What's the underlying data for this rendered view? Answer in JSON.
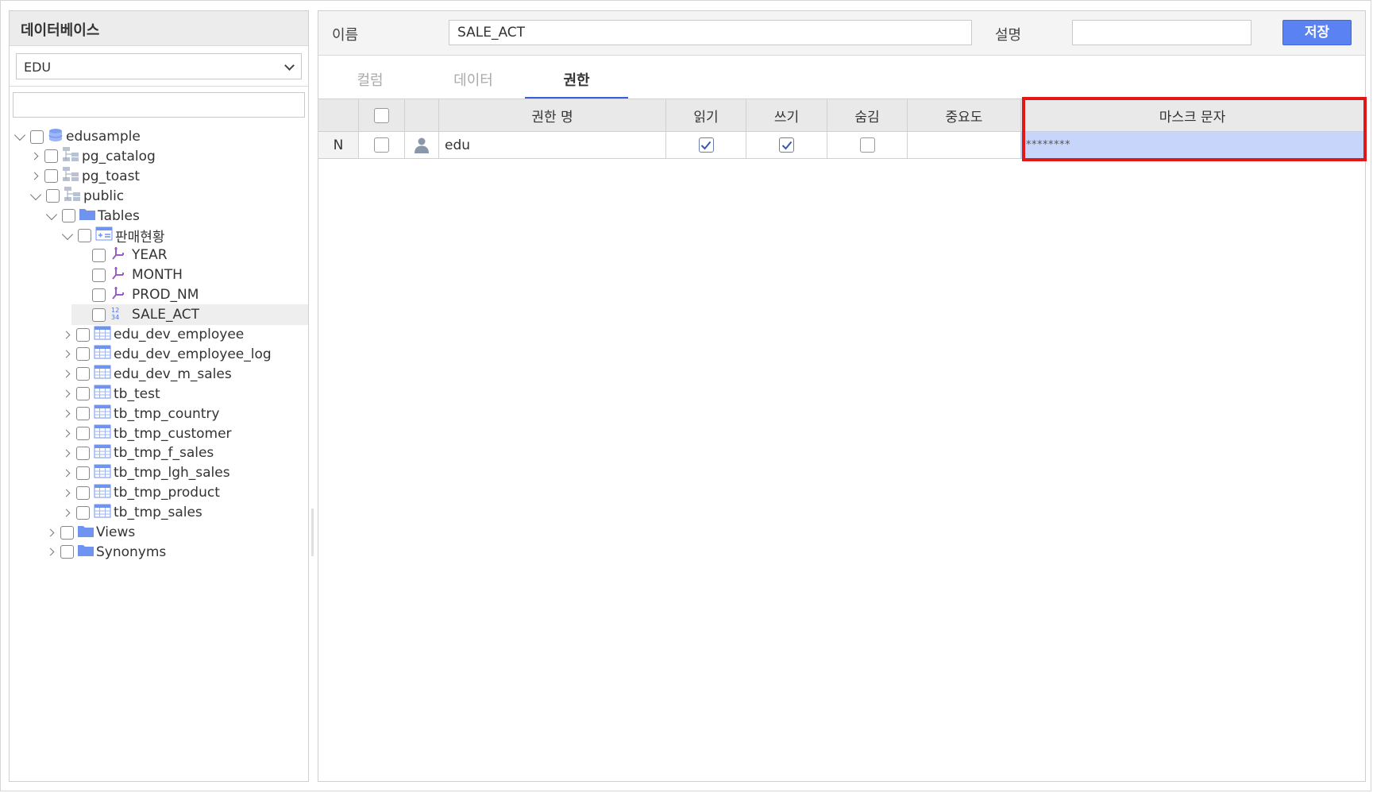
{
  "left": {
    "header": "데이터베이스",
    "db_select": "EDU",
    "search_value": "",
    "tree": [
      {
        "label": "edusample",
        "icon": "database-icon",
        "state": "open",
        "depth": 0
      },
      {
        "label": "pg_catalog",
        "icon": "schema-icon",
        "state": "closed",
        "depth": 1
      },
      {
        "label": "pg_toast",
        "icon": "schema-icon",
        "state": "closed",
        "depth": 1
      },
      {
        "label": "public",
        "icon": "schema-icon",
        "state": "open",
        "depth": 1
      },
      {
        "label": "Tables",
        "icon": "folder-icon",
        "state": "open",
        "depth": 2
      },
      {
        "label": "판매현황",
        "icon": "view-table-icon",
        "state": "open",
        "depth": 3
      },
      {
        "label": "YEAR",
        "icon": "text-column-icon",
        "state": "none",
        "depth": 4
      },
      {
        "label": "MONTH",
        "icon": "text-column-icon",
        "state": "none",
        "depth": 4
      },
      {
        "label": "PROD_NM",
        "icon": "text-column-icon",
        "state": "none",
        "depth": 4
      },
      {
        "label": "SALE_ACT",
        "icon": "number-column-icon",
        "state": "none",
        "depth": 4,
        "selected": true
      },
      {
        "label": "edu_dev_employee",
        "icon": "table-icon",
        "state": "closed",
        "depth": 3
      },
      {
        "label": "edu_dev_employee_log",
        "icon": "table-icon",
        "state": "closed",
        "depth": 3
      },
      {
        "label": "edu_dev_m_sales",
        "icon": "table-icon",
        "state": "closed",
        "depth": 3
      },
      {
        "label": "tb_test",
        "icon": "table-icon",
        "state": "closed",
        "depth": 3
      },
      {
        "label": "tb_tmp_country",
        "icon": "table-icon",
        "state": "closed",
        "depth": 3
      },
      {
        "label": "tb_tmp_customer",
        "icon": "table-icon",
        "state": "closed",
        "depth": 3
      },
      {
        "label": "tb_tmp_f_sales",
        "icon": "table-icon",
        "state": "closed",
        "depth": 3
      },
      {
        "label": "tb_tmp_lgh_sales",
        "icon": "table-icon",
        "state": "closed",
        "depth": 3
      },
      {
        "label": "tb_tmp_product",
        "icon": "table-icon",
        "state": "closed",
        "depth": 3
      },
      {
        "label": "tb_tmp_sales",
        "icon": "table-icon",
        "state": "closed",
        "depth": 3
      },
      {
        "label": "Views",
        "icon": "folder-icon",
        "state": "closed",
        "depth": 2
      },
      {
        "label": "Synonyms",
        "icon": "folder-icon",
        "state": "closed",
        "depth": 2
      }
    ]
  },
  "right": {
    "name_label": "이름",
    "name_value": "SALE_ACT",
    "desc_label": "설명",
    "desc_value": "",
    "save_label": "저장",
    "tabs": [
      {
        "label": "컬럼",
        "active": false
      },
      {
        "label": "데이터",
        "active": false
      },
      {
        "label": "권한",
        "active": true
      }
    ],
    "grid": {
      "headers": {
        "name": "권한 명",
        "read": "읽기",
        "write": "쓰기",
        "hide": "숨김",
        "importance": "중요도",
        "mask": "마스크 문자"
      },
      "rows": [
        {
          "status": "N",
          "checked": false,
          "name": "edu",
          "read": true,
          "write": true,
          "hide": false,
          "importance": "",
          "mask": "********"
        }
      ]
    }
  },
  "colors": {
    "accent": "#5b82f2",
    "highlight": "#e01818",
    "mask_cell_bg": "#c7d5fa"
  }
}
